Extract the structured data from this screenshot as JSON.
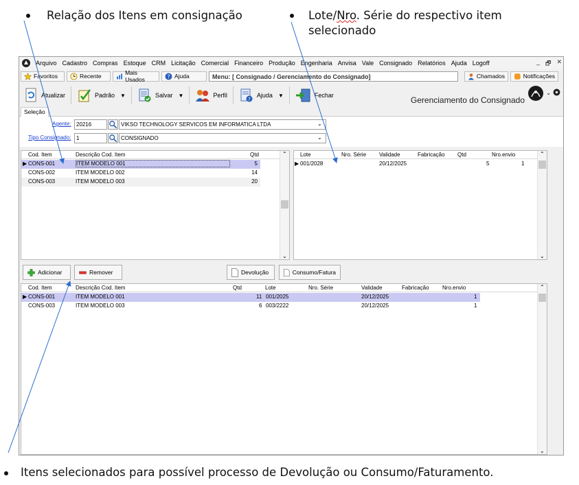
{
  "annotations": {
    "top_left": "Relação dos Itens em consignação",
    "top_right_line1_pre": "Lote/",
    "top_right_line1_wavy": "Nro",
    "top_right_line1_post": ". Série do respectivo item",
    "top_right_line2": "selecionado",
    "bottom": "Itens selecionados para possível processo de Devolução ou Consumo/Faturamento."
  },
  "menu": [
    "Arquivo",
    "Cadastro",
    "Compras",
    "Estoque",
    "CRM",
    "Licitação",
    "Comercial",
    "Financeiro",
    "Produção",
    "Engenharia",
    "Anvisa",
    "Vale",
    "Consignado",
    "Relatórios",
    "Ajuda",
    "Logoff"
  ],
  "window_controls": [
    "_",
    "🗗",
    "✕"
  ],
  "toolbar1": {
    "favoritos": "Favoritos",
    "recente": "Recente",
    "mais_usados": "Mais Usados",
    "ajuda": "Ajuda",
    "menu_path": "Menu: [ Consignado / Gerenciamento do Consignado]",
    "chamados": "Chamados",
    "notificacoes": "Notificações"
  },
  "toolbar2": {
    "atualizar": "Atualizar",
    "padrao": "Padrão",
    "salvar": "Salvar",
    "perfil": "Perfil",
    "ajuda": "Ajuda",
    "fechar": "Fechar"
  },
  "screen_title": "Gerenciamento do Consignado",
  "tab": "Seleção",
  "fields": {
    "agente_label": "Agente:",
    "agente_code": "20216",
    "agente_name": "VIKSO TECHNOLOGY SERVICOS EM INFORMATICA LTDA",
    "tipo_label": "Tipo Consignado:",
    "tipo_code": "1",
    "tipo_name": "CONSIGNADO"
  },
  "items_grid": {
    "headers": [
      "Cod. Item",
      "Descrição Cod. Item",
      "Qtd"
    ],
    "rows": [
      [
        "CONS-001",
        "ITEM MODELO 001",
        "5"
      ],
      [
        "CONS-002",
        "ITEM MODELO 002",
        "14"
      ],
      [
        "CONS-003",
        "ITEM MODELO 003",
        "20"
      ]
    ]
  },
  "lote_grid": {
    "headers": [
      "Lote",
      "Nro. Série",
      "Validade",
      "Fabricação",
      "Qtd",
      "Nro.envio"
    ],
    "rows": [
      [
        "001/2028",
        "",
        "20/12/2025",
        "",
        "5",
        "1"
      ]
    ]
  },
  "buttons": {
    "adicionar": "Adicionar",
    "remover": "Remover",
    "devolucao": "Devolução",
    "consumo": "Consumo/Fatura"
  },
  "selected_grid": {
    "headers": [
      "Cod. Item",
      "Descrição Cod. Item",
      "Qtd",
      "Lote",
      "Nro. Série",
      "Validade",
      "Fabricação",
      "Nro.envio"
    ],
    "rows": [
      [
        "CONS-001",
        "ITEM MODELO 001",
        "11",
        "001/2025",
        "",
        "20/12/2025",
        "",
        "1"
      ],
      [
        "CONS-003",
        "ITEM MODELO 003",
        "6",
        "003/2222",
        "",
        "20/12/2025",
        "",
        "1"
      ]
    ]
  }
}
